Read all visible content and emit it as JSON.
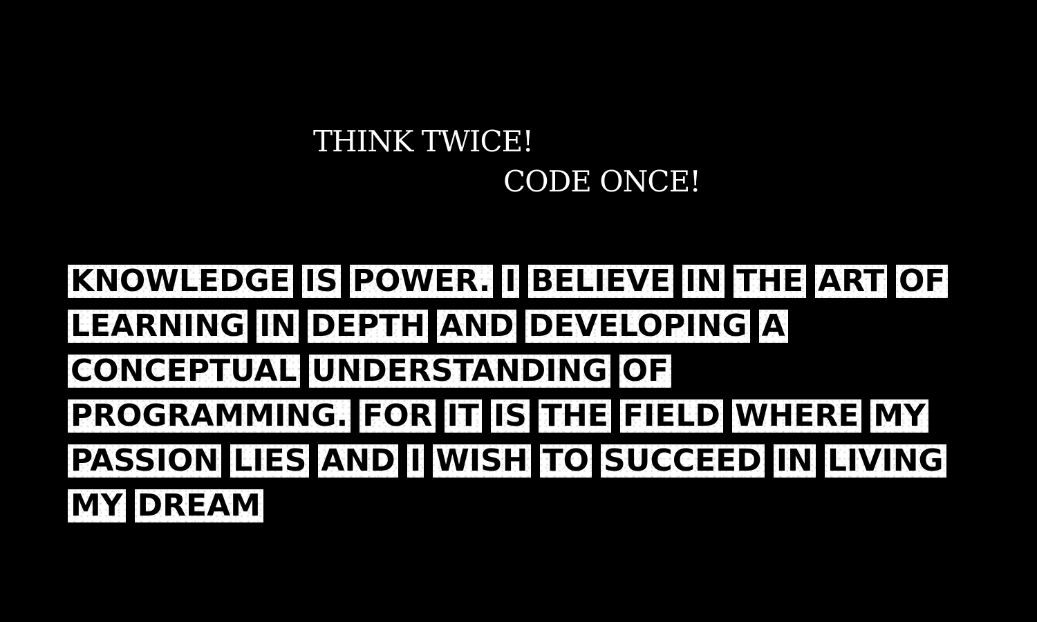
{
  "slogan": {
    "line1": "THINK TWICE!",
    "line2": "CODE ONCE!"
  },
  "statement": {
    "lines": [
      [
        "KNOWLEDGE",
        "IS",
        "POWER.",
        "I",
        "BELIEVE",
        "IN",
        "THE",
        "ART",
        "OF"
      ],
      [
        "LEARNING",
        "IN",
        "DEPTH",
        "AND",
        "DEVELOPING",
        "A"
      ],
      [
        "CONCEPTUAL",
        "UNDERSTANDING",
        "OF"
      ],
      [
        "PROGRAMMING.",
        "FOR",
        "IT",
        "IS",
        "THE",
        "FIELD",
        "WHERE",
        "MY"
      ],
      [
        "PASSION",
        "LIES",
        "AND",
        "I",
        "WISH",
        "TO",
        "SUCCEED",
        "IN",
        "LIVING"
      ],
      [
        "MY",
        "DREAM"
      ]
    ]
  },
  "colors": {
    "background": "#000000",
    "slogan_text": "#ffffff",
    "word_block": "#ffffff",
    "word_text": "#000000"
  }
}
